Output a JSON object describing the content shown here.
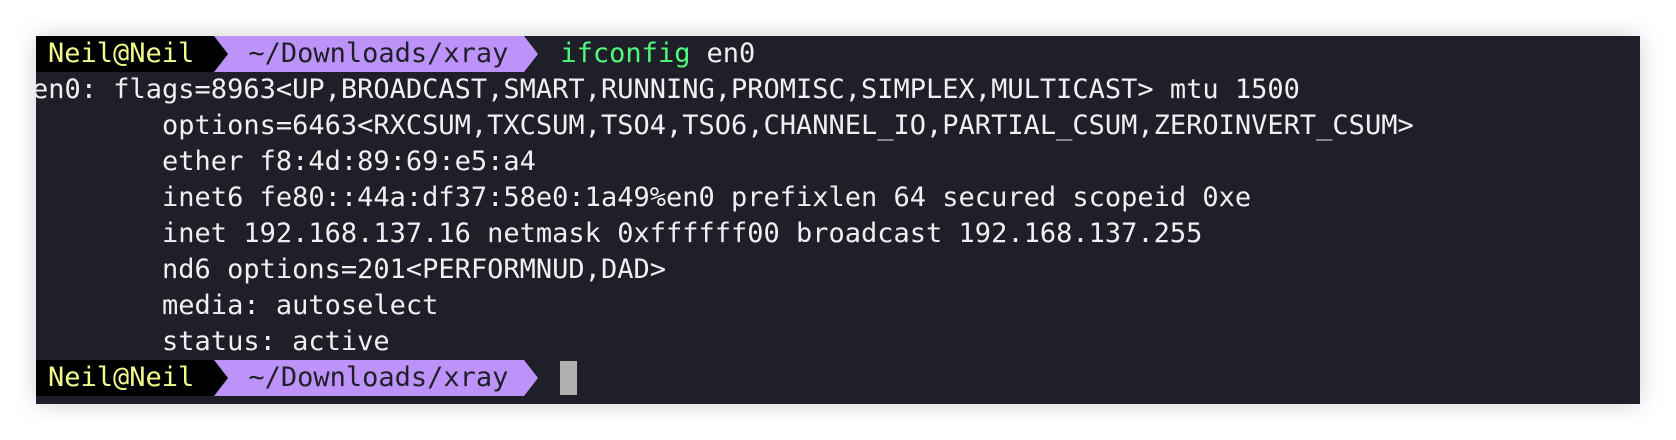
{
  "terminal": {
    "prompt_user": "Neil@Neil",
    "prompt_path": "~/Downloads/xray",
    "command": "ifconfig",
    "command_arg": "en0",
    "output": [
      "en0: flags=8963<UP,BROADCAST,SMART,RUNNING,PROMISC,SIMPLEX,MULTICAST> mtu 1500",
      "        options=6463<RXCSUM,TXCSUM,TSO4,TSO6,CHANNEL_IO,PARTIAL_CSUM,ZEROINVERT_CSUM>",
      "        ether f8:4d:89:69:e5:a4",
      "        inet6 fe80::44a:df37:58e0:1a49%en0 prefixlen 64 secured scopeid 0xe",
      "        inet 192.168.137.16 netmask 0xffffff00 broadcast 192.168.137.255",
      "        nd6 options=201<PERFORMNUD,DAD>",
      "        media: autoselect",
      "        status: active"
    ],
    "colors": {
      "background": "#1e1f29",
      "user_segment_bg": "#000000",
      "user_segment_fg": "#f1fa8c",
      "path_segment_bg": "#bd93f9",
      "command_fg": "#50fa7b",
      "text_fg": "#f0f0f0",
      "cursor": "#b0b0b0"
    }
  }
}
